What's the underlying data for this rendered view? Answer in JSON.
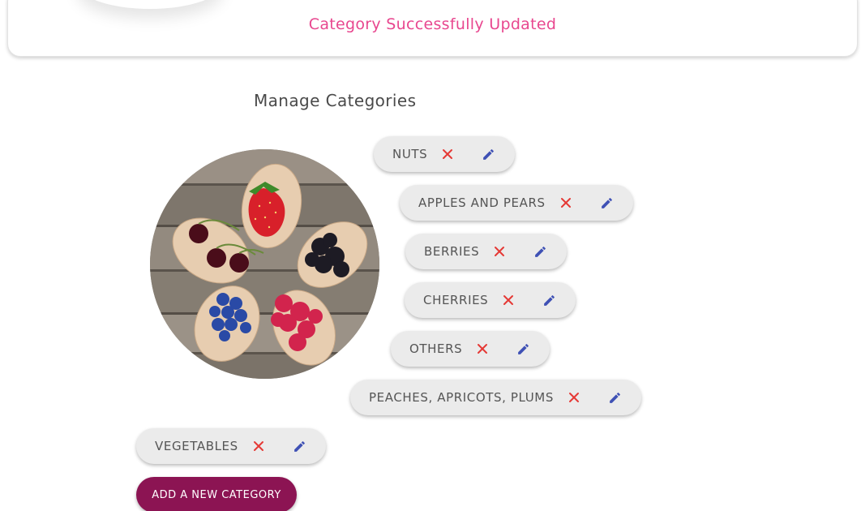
{
  "notification": {
    "message": "Category Successfully Updated",
    "color": "#e8478f"
  },
  "page": {
    "title": "Manage Categories"
  },
  "categories": [
    {
      "label": "NUTS",
      "delete_icon": "close-icon",
      "edit_icon": "pencil-icon"
    },
    {
      "label": "APPLES AND PEARS",
      "delete_icon": "close-icon",
      "edit_icon": "pencil-icon"
    },
    {
      "label": "BERRIES",
      "delete_icon": "close-icon",
      "edit_icon": "pencil-icon"
    },
    {
      "label": "CHERRIES",
      "delete_icon": "close-icon",
      "edit_icon": "pencil-icon"
    },
    {
      "label": "OTHERS",
      "delete_icon": "close-icon",
      "edit_icon": "pencil-icon"
    },
    {
      "label": "PEACHES, APRICOTS, PLUMS",
      "delete_icon": "close-icon",
      "edit_icon": "pencil-icon"
    },
    {
      "label": "VEGETABLES",
      "delete_icon": "close-icon",
      "edit_icon": "pencil-icon"
    }
  ],
  "actions": {
    "add_label": "ADD A NEW CATEGORY"
  },
  "colors": {
    "delete_icon": "#e53935",
    "edit_icon": "#3f51b5",
    "chip_background": "#ebebeb",
    "add_button": "#8c1453"
  }
}
